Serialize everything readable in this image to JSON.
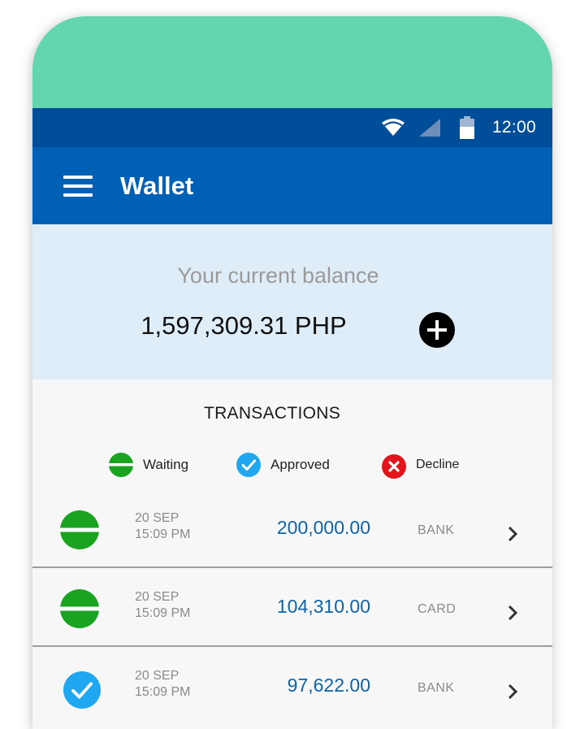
{
  "status_bar": {
    "time": "12:00",
    "icons": [
      "wifi-icon",
      "cell-signal-icon",
      "battery-icon"
    ]
  },
  "app_bar": {
    "menu_icon": "hamburger-menu-icon",
    "title": "Wallet"
  },
  "balance": {
    "label": "Your current balance",
    "value": "1,597,309.31 PHP",
    "add_icon": "plus-circle-icon"
  },
  "transactions": {
    "title": "TRANSACTIONS",
    "legend": {
      "waiting": "Waiting",
      "approved": "Approved",
      "decline": "Decline"
    },
    "rows": [
      {
        "status": "waiting",
        "date": "20 SEP",
        "time": "15:09 PM",
        "amount": "200,000.00",
        "method": "BANK"
      },
      {
        "status": "waiting",
        "date": "20 SEP",
        "time": "15:09 PM",
        "amount": "104,310.00",
        "method": "CARD"
      },
      {
        "status": "approved",
        "date": "20 SEP",
        "time": "15:09 PM",
        "amount": "97,622.00",
        "method": "BANK"
      }
    ]
  },
  "colors": {
    "device_top": "#63d6b0",
    "status_bar": "#004e99",
    "app_bar": "#0060b6",
    "balance_panel": "#deedf8",
    "waiting": "#1aa321",
    "approved": "#1fa8f1",
    "decline": "#e2141c",
    "amount": "#0d63aa"
  }
}
